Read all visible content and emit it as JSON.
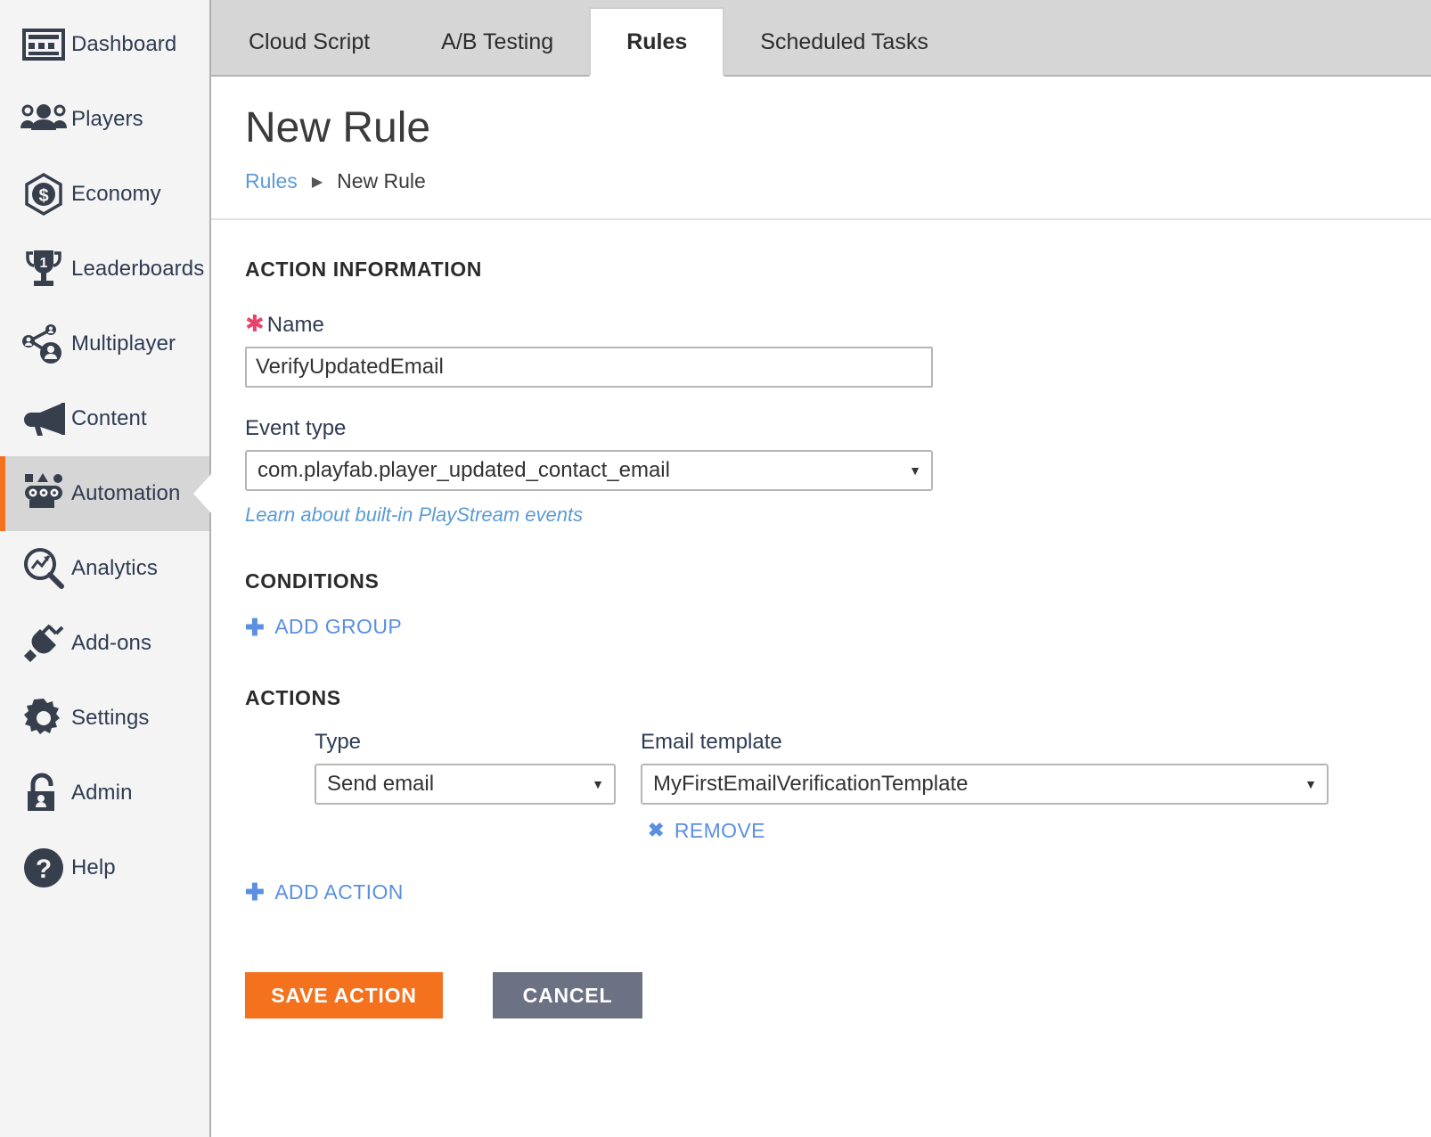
{
  "sidebar": {
    "items": [
      {
        "label": "Dashboard",
        "icon": "dashboard-icon",
        "active": false
      },
      {
        "label": "Players",
        "icon": "players-icon",
        "active": false
      },
      {
        "label": "Economy",
        "icon": "economy-icon",
        "active": false
      },
      {
        "label": "Leaderboards",
        "icon": "leaderboards-icon",
        "active": false
      },
      {
        "label": "Multiplayer",
        "icon": "multiplayer-icon",
        "active": false
      },
      {
        "label": "Content",
        "icon": "content-icon",
        "active": false
      },
      {
        "label": "Automation",
        "icon": "automation-icon",
        "active": true
      },
      {
        "label": "Analytics",
        "icon": "analytics-icon",
        "active": false
      },
      {
        "label": "Add-ons",
        "icon": "addons-icon",
        "active": false
      },
      {
        "label": "Settings",
        "icon": "settings-gear-icon",
        "active": false
      },
      {
        "label": "Admin",
        "icon": "lock-icon",
        "active": false
      },
      {
        "label": "Help",
        "icon": "help-question-icon",
        "active": false
      }
    ]
  },
  "tabs": [
    {
      "label": "Cloud Script",
      "active": false
    },
    {
      "label": "A/B Testing",
      "active": false
    },
    {
      "label": "Rules",
      "active": true
    },
    {
      "label": "Scheduled Tasks",
      "active": false
    }
  ],
  "header": {
    "title": "New Rule",
    "breadcrumb_root": "Rules",
    "breadcrumb_sep": "▶",
    "breadcrumb_current": "New Rule"
  },
  "action_information": {
    "section_title": "ACTION INFORMATION",
    "name_label": "Name",
    "required_marker": "✱",
    "name_value": "VerifyUpdatedEmail",
    "name_placeholder": "",
    "event_type_label": "Event type",
    "event_type_value": "com.playfab.player_updated_contact_email",
    "learn_link": "Learn about built-in PlayStream events"
  },
  "conditions": {
    "section_title": "CONDITIONS",
    "add_group_label": "ADD GROUP",
    "add_group_glyph": "✚"
  },
  "actions": {
    "section_title": "ACTIONS",
    "type_label": "Type",
    "type_value": "Send email",
    "email_template_label": "Email template",
    "email_template_value": "MyFirstEmailVerificationTemplate",
    "remove_label": "REMOVE",
    "remove_glyph": "✖",
    "add_action_label": "ADD ACTION",
    "add_action_glyph": "✚",
    "caret_glyph": "▼"
  },
  "footer": {
    "save_label": "SAVE ACTION",
    "cancel_label": "CANCEL"
  },
  "colors": {
    "accent_orange": "#f4721e",
    "link_blue": "#5b8fe0",
    "required_pink": "#e8446b",
    "cancel_gray": "#6c7183",
    "sidebar_bg": "#f4f4f4",
    "sidebar_active_bg": "#d6d6d6",
    "tabbar_bg": "#d6d6d6"
  }
}
